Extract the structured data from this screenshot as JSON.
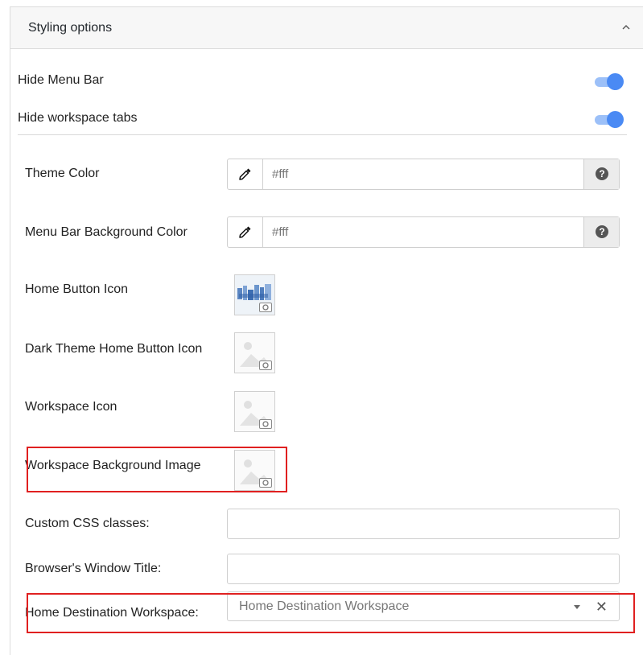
{
  "panel": {
    "title": "Styling options",
    "collapse_icon": "chevron-up-icon"
  },
  "toggles": [
    {
      "label": "Hide Menu Bar",
      "on": true
    },
    {
      "label": "Hide workspace tabs",
      "on": true
    }
  ],
  "colors": {
    "toggle_track": "#9cc0f8",
    "toggle_knob": "#4a8af4",
    "highlight": "#e02020"
  },
  "theme_color": {
    "label": "Theme Color",
    "placeholder": "#fff",
    "picker_icon": "eyedropper-icon",
    "help_icon": "help-icon",
    "help_glyph": "?"
  },
  "menu_bar_bg_color": {
    "label": "Menu Bar Background Color",
    "placeholder": "#fff",
    "picker_icon": "eyedropper-icon",
    "help_icon": "help-icon",
    "help_glyph": "?"
  },
  "images": [
    {
      "label": "Home Button Icon",
      "has_image": true
    },
    {
      "label": "Dark Theme Home Button Icon",
      "has_image": false
    },
    {
      "label": "Workspace Icon",
      "has_image": false
    },
    {
      "label": "Workspace Background Image",
      "has_image": false
    }
  ],
  "custom_css": {
    "label": "Custom CSS classes:",
    "value": ""
  },
  "window_title": {
    "label": "Browser's Window Title:",
    "value": ""
  },
  "home_destination": {
    "label": "Home Destination Workspace:",
    "placeholder": "Home Destination Workspace",
    "clear_glyph": "✕"
  }
}
